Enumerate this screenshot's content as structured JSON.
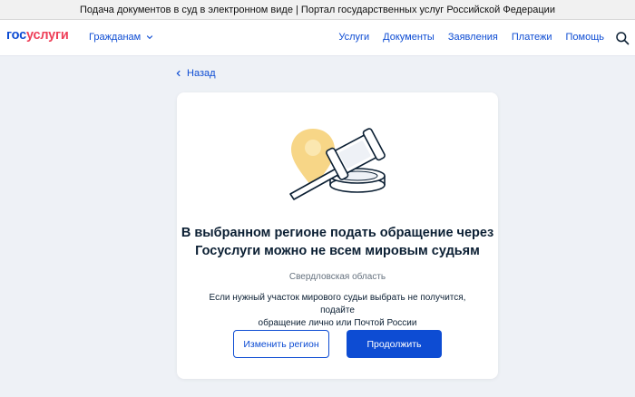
{
  "window": {
    "title": "Подача документов в суд в электронном виде | Портал государственных услуг Российской Федерации"
  },
  "header": {
    "logo_part1": "гос",
    "logo_part2": "услуги",
    "audience_label": "Гражданам",
    "nav": [
      "Услуги",
      "Документы",
      "Заявления",
      "Платежи",
      "Помощь"
    ],
    "search_icon": "search-icon"
  },
  "back": {
    "label": "Назад"
  },
  "card": {
    "illustration": "gavel-location-pin",
    "heading_line1": "В выбранном регионе подать обращение через",
    "heading_line2": "Госуслуги можно не всем мировым судьям",
    "region": "Свердловская область",
    "info_line1": "Если нужный участок мирового судьи выбрать не получится, подайте",
    "info_line2": "обращение лично или Почтой России",
    "change_region_label": "Изменить регион",
    "continue_label": "Продолжить"
  },
  "colors": {
    "brand_blue": "#0d4cd3",
    "brand_red": "#ee3f58",
    "pin_yellow": "#f6d27a",
    "background": "#eef1f6"
  }
}
